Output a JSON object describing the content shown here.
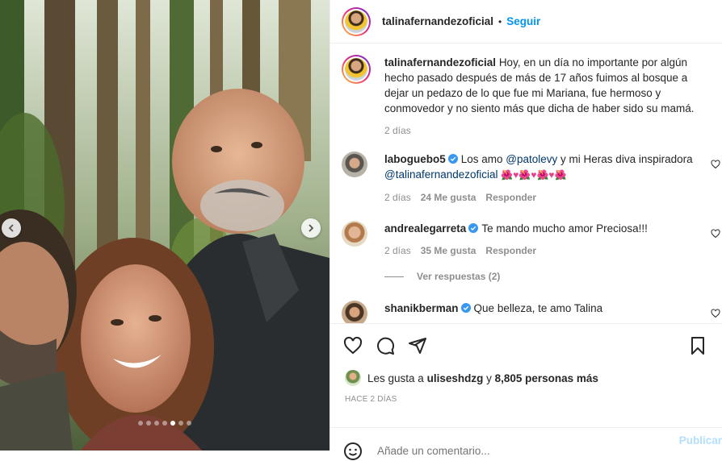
{
  "post": {
    "author": "talinafernandezoficial",
    "separator": "•",
    "follow_label": "Seguir",
    "caption": "Hoy, en un día no importante por algún hecho pasado después de más de 17 años fuimos al bosque a dejar un pedazo de lo que fue mi Mariana, fue hermoso y conmovedor y no siento más que dicha de haber sido su mamá.",
    "caption_time": "2 días",
    "carousel_count": 7,
    "carousel_active": 4
  },
  "comments": [
    {
      "user": "laboguebo5",
      "verified": true,
      "text_before": "Los amo ",
      "mention1": "@patolevy",
      "text_middle": " y mi Heras diva inspiradora",
      "mention2": "@talinafernandezoficial",
      "emoji_row": "🌺♥🌺♥🌺♥🌺",
      "time": "2 días",
      "likes": "24 Me gusta",
      "reply": "Responder"
    },
    {
      "user": "andrealegarreta",
      "verified": true,
      "text": "Te mando mucho amor Preciosa!!!",
      "time": "2 días",
      "likes": "35 Me gusta",
      "reply": "Responder",
      "view_replies": "Ver respuestas (2)"
    },
    {
      "user": "shanikberman",
      "verified": true,
      "text": "Que belleza, te amo Talina"
    }
  ],
  "likes": {
    "prefix": "Les gusta a ",
    "user": "uliseshdzg",
    "middle": " y ",
    "count": "8,805 personas más"
  },
  "timestamp": "HACE 2 DÍAS",
  "composer": {
    "placeholder": "Añade un comentario...",
    "publish": "Publicar"
  },
  "icons": {
    "like": "heart-icon",
    "comment": "comment-icon",
    "share": "share-icon",
    "save": "bookmark-icon",
    "emoji": "emoji-icon",
    "prev": "chevron-left-icon",
    "next": "chevron-right-icon"
  },
  "colors": {
    "accent": "#0095f6",
    "muted": "#8e8e8e",
    "mention": "#00376b",
    "verified": "#3897f0",
    "publish_disabled": "#b2dffc"
  }
}
